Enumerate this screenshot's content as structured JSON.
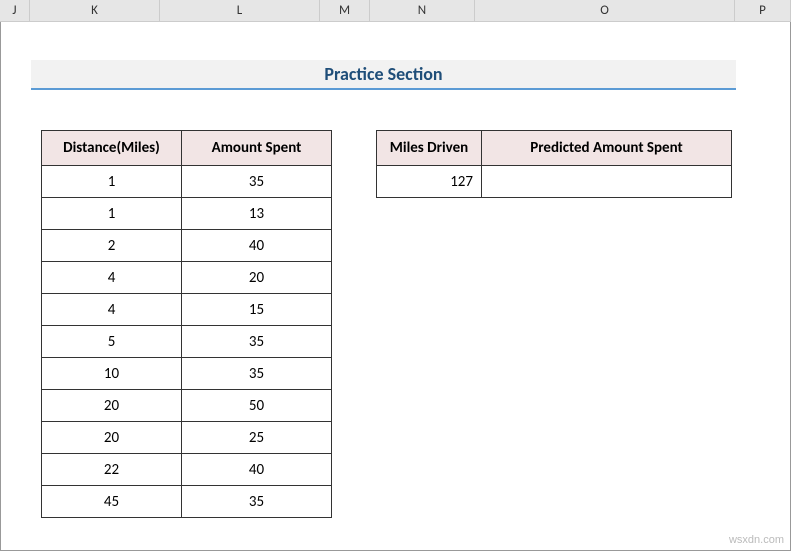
{
  "columns": [
    "J",
    "K",
    "L",
    "M",
    "N",
    "O",
    "P"
  ],
  "title": "Practice Section",
  "table1": {
    "headers": [
      "Distance(Miles)",
      "Amount Spent"
    ],
    "rows": [
      {
        "dist": "1",
        "amt": "35"
      },
      {
        "dist": "1",
        "amt": "13"
      },
      {
        "dist": "2",
        "amt": "40"
      },
      {
        "dist": "4",
        "amt": "20"
      },
      {
        "dist": "4",
        "amt": "15"
      },
      {
        "dist": "5",
        "amt": "35"
      },
      {
        "dist": "10",
        "amt": "35"
      },
      {
        "dist": "20",
        "amt": "50"
      },
      {
        "dist": "20",
        "amt": "25"
      },
      {
        "dist": "22",
        "amt": "40"
      },
      {
        "dist": "45",
        "amt": "35"
      }
    ]
  },
  "table2": {
    "headers": [
      "Miles Driven",
      "Predicted Amount Spent"
    ],
    "miles": "127",
    "predicted": ""
  },
  "watermark": "wsxdn.com"
}
